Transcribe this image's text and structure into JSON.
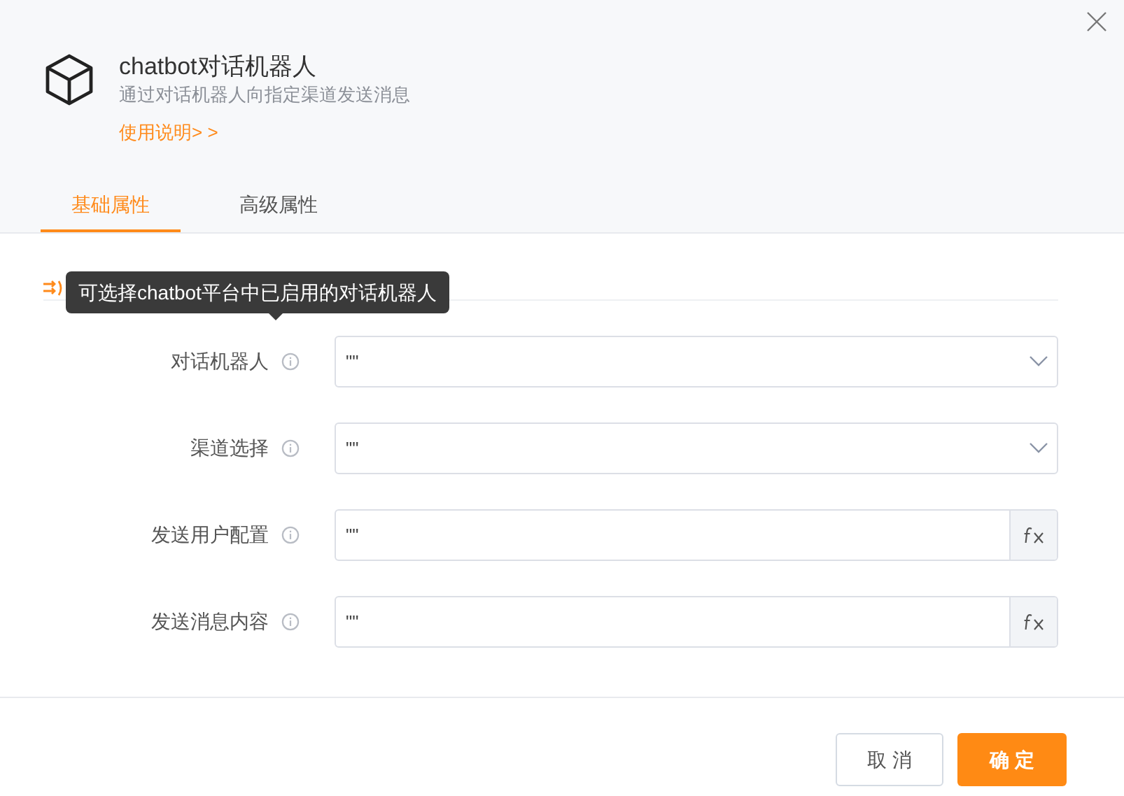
{
  "header": {
    "title": "chatbot对话机器人",
    "subtitle": "通过对话机器人向指定渠道发送消息",
    "help_link": "使用说明> >"
  },
  "tabs": [
    {
      "label": "基础属性",
      "selected": true
    },
    {
      "label": "高级属性",
      "selected": false
    }
  ],
  "tooltip": "可选择chatbot平台中已启用的对话机器人",
  "fields": [
    {
      "label": "对话机器人",
      "kind": "select",
      "value": "\"\""
    },
    {
      "label": "渠道选择",
      "kind": "select",
      "value": "\"\""
    },
    {
      "label": "发送用户配置",
      "kind": "formula",
      "value": "\"\""
    },
    {
      "label": "发送消息内容",
      "kind": "formula",
      "value": "\"\""
    }
  ],
  "buttons": {
    "cancel": "取 消",
    "confirm": "确 定"
  }
}
